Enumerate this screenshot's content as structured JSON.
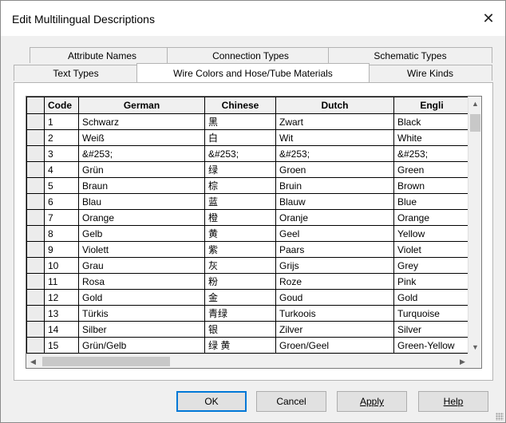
{
  "window": {
    "title": "Edit Multilingual Descriptions",
    "close_glyph": "✕"
  },
  "tabs": {
    "row_back": [
      "Attribute Names",
      "Connection Types",
      "Schematic Types"
    ],
    "row_front": [
      "Text Types",
      "Wire Colors and Hose/Tube Materials",
      "Wire Kinds"
    ],
    "active": "Wire Colors and Hose/Tube Materials"
  },
  "grid": {
    "columns": [
      "Code",
      "German",
      "Chinese",
      "Dutch",
      "Engli"
    ],
    "rows": [
      [
        "1",
        "Schwarz",
        "黑",
        "Zwart",
        "Black"
      ],
      [
        "2",
        "Weiß",
        "白",
        "Wit",
        "White"
      ],
      [
        "3",
        "&#253;",
        "&#253;",
        "&#253;",
        "&#253;"
      ],
      [
        "4",
        "Grün",
        "绿",
        "Groen",
        "Green"
      ],
      [
        "5",
        "Braun",
        "棕",
        "Bruin",
        "Brown"
      ],
      [
        "6",
        "Blau",
        "蓝",
        "Blauw",
        "Blue"
      ],
      [
        "7",
        "Orange",
        "橙",
        "Oranje",
        "Orange"
      ],
      [
        "8",
        "Gelb",
        "黄",
        "Geel",
        "Yellow"
      ],
      [
        "9",
        "Violett",
        "紫",
        "Paars",
        "Violet"
      ],
      [
        "10",
        "Grau",
        "灰",
        "Grijs",
        "Grey"
      ],
      [
        "11",
        "Rosa",
        "粉",
        "Roze",
        "Pink"
      ],
      [
        "12",
        "Gold",
        "金",
        "Goud",
        "Gold"
      ],
      [
        "13",
        "Türkis",
        "青绿",
        "Turkoois",
        "Turquoise"
      ],
      [
        "14",
        "Silber",
        "银",
        "Zilver",
        "Silver"
      ],
      [
        "15",
        "Grün/Gelb",
        "绿 黄",
        "Groen/Geel",
        "Green-Yellow"
      ]
    ],
    "highlighted_row": 2,
    "highlight_color": "#14c81e"
  },
  "buttons": {
    "ok": "OK",
    "cancel": "Cancel",
    "apply": "Apply",
    "help": "Help"
  },
  "icons": {
    "scroll_up": "▲",
    "scroll_down": "▼",
    "scroll_left": "◀",
    "scroll_right": "▶"
  }
}
